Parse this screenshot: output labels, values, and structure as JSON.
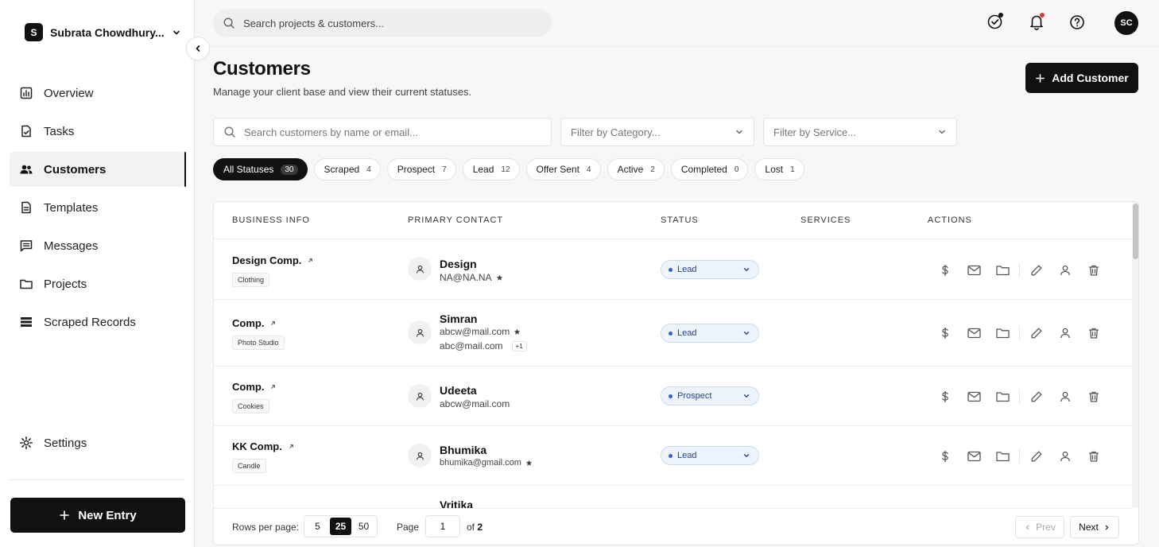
{
  "workspace": {
    "initial": "S",
    "name": "Subrata Chowdhury..."
  },
  "nav": {
    "overview": "Overview",
    "tasks": "Tasks",
    "customers": "Customers",
    "templates": "Templates",
    "messages": "Messages",
    "projects": "Projects",
    "scraped": "Scraped Records",
    "settings": "Settings"
  },
  "new_entry_label": "New Entry",
  "topbar": {
    "search_placeholder": "Search projects & customers...",
    "avatar_initials": "SC",
    "notification_dot_color": "#e5372f"
  },
  "header": {
    "title": "Customers",
    "subtitle": "Manage your client base and view their current statuses.",
    "add_label": "Add Customer"
  },
  "filters": {
    "search_placeholder": "Search customers by name or email...",
    "category_placeholder": "Filter by Category...",
    "service_placeholder": "Filter by Service..."
  },
  "status_chips": [
    {
      "label": "All Statuses",
      "count": "30"
    },
    {
      "label": "Scraped",
      "count": "4"
    },
    {
      "label": "Prospect",
      "count": "7"
    },
    {
      "label": "Lead",
      "count": "12"
    },
    {
      "label": "Offer Sent",
      "count": "4"
    },
    {
      "label": "Active",
      "count": "2"
    },
    {
      "label": "Completed",
      "count": "0"
    },
    {
      "label": "Lost",
      "count": "1"
    }
  ],
  "table": {
    "columns": [
      "BUSINESS INFO",
      "PRIMARY CONTACT",
      "STATUS",
      "SERVICES",
      "ACTIONS"
    ],
    "rows": [
      {
        "business": "Design Comp.",
        "category": "Clothing",
        "contact": "Design",
        "email": "NA@NA.NA",
        "email2": "",
        "extra": "",
        "status": "Lead"
      },
      {
        "business": "Comp.",
        "category": "Photo Studio",
        "contact": "Simran",
        "email": "abcw@mail.com",
        "email2": "abc@mail.com",
        "extra": "+1",
        "status": "Lead"
      },
      {
        "business": "Comp.",
        "category": "Cookies",
        "contact": "Udeeta",
        "email": "abcw@mail.com",
        "email2": "",
        "extra": "",
        "status": "Prospect"
      },
      {
        "business": "KK Comp.",
        "category": "Candle",
        "contact": "Bhumika",
        "email": "bhumika@gmail.com",
        "email2": "",
        "extra": "",
        "status": "Lead"
      },
      {
        "business": "",
        "category": "",
        "contact": "Vritika",
        "email": "",
        "email2": "",
        "extra": "",
        "status": ""
      }
    ]
  },
  "pagination": {
    "rows_label": "Rows per page:",
    "options": [
      "5",
      "25",
      "50"
    ],
    "selected": "25",
    "page_label": "Page",
    "page_value": "1",
    "of_label": "of",
    "total_pages": "2",
    "prev_label": "Prev",
    "next_label": "Next"
  },
  "colors": {
    "accent": "#111111",
    "status_bg": "#eef4fd",
    "status_text": "#1f3f9c",
    "status_dot": "#2f62e0"
  }
}
